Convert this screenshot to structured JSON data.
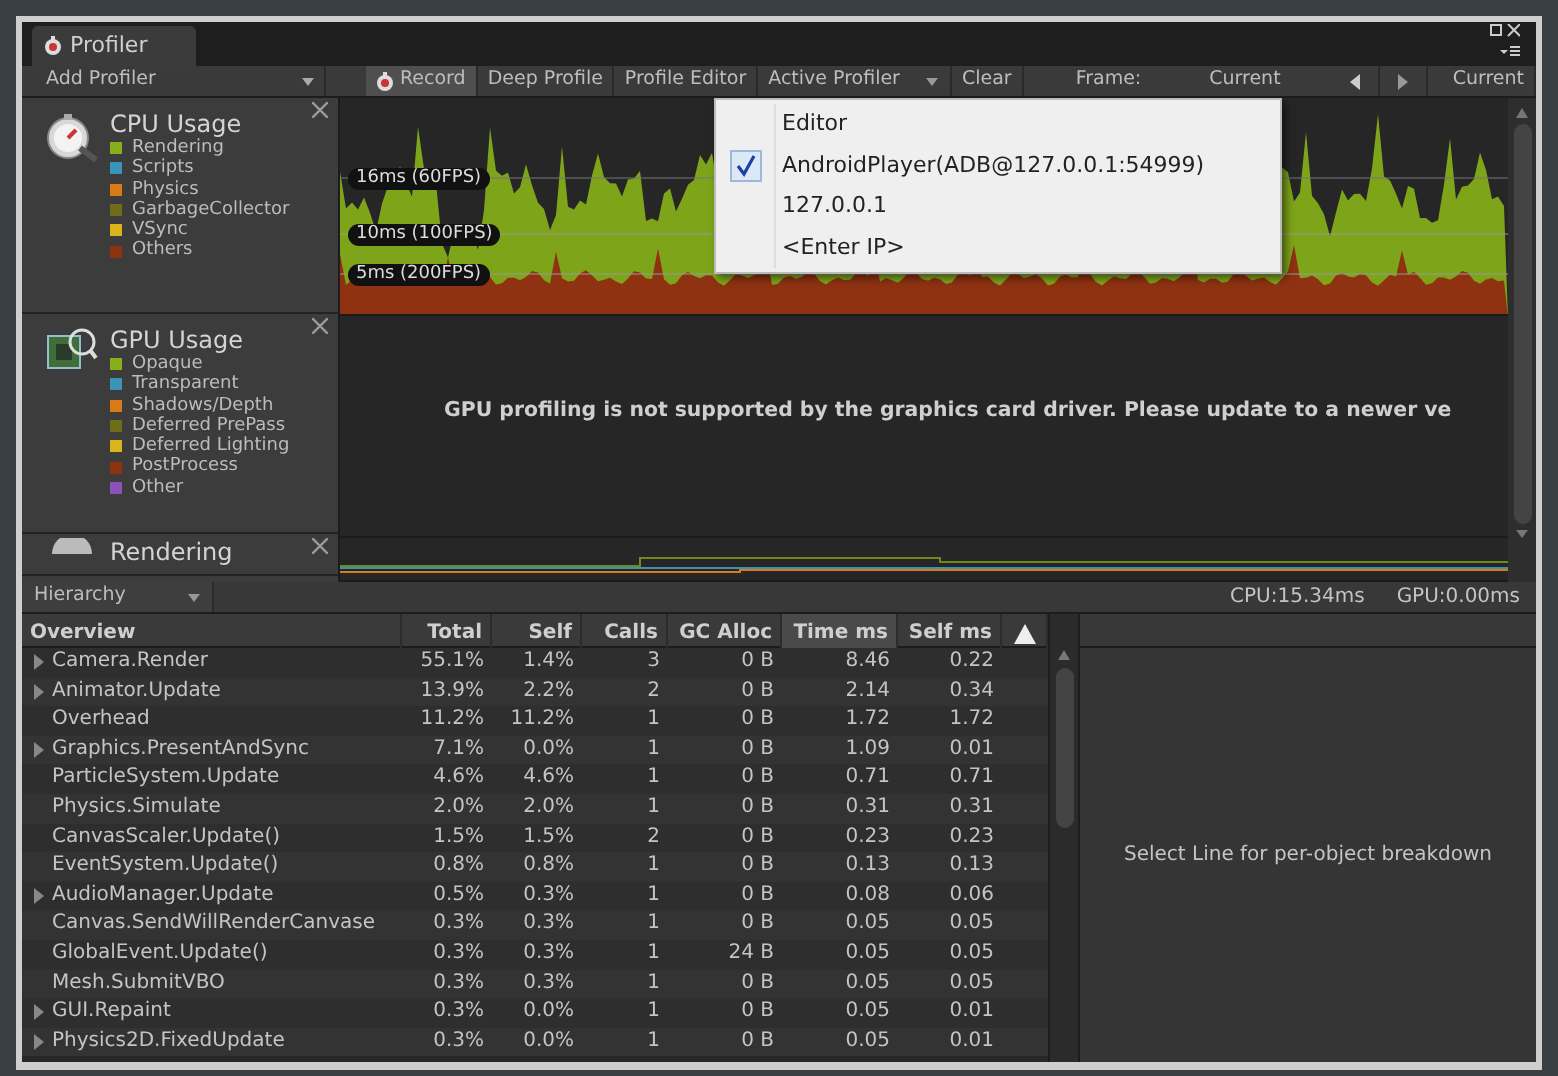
{
  "window": {
    "tab_title": "Profiler"
  },
  "toolbar": {
    "add_profiler": "Add Profiler",
    "buttons": [
      {
        "label": "Record",
        "kind": "record",
        "on": true
      },
      {
        "label": "Deep Profile",
        "kind": "toggle",
        "on": false
      },
      {
        "label": "Profile Editor",
        "kind": "toggle",
        "on": false
      },
      {
        "label": "Active Profiler",
        "kind": "dropdown",
        "on": false
      },
      {
        "label": "Clear",
        "kind": "toggle",
        "on": false
      }
    ],
    "frame_label": "Frame:",
    "frame_value": "Current",
    "current_button": "Current"
  },
  "active_profiler_menu": [
    {
      "label": "Editor",
      "checked": false
    },
    {
      "label": "AndroidPlayer(ADB@127.0.0.1:54999)",
      "checked": true
    },
    {
      "label": "127.0.0.1",
      "checked": false
    },
    {
      "label": "<Enter IP>",
      "checked": false
    }
  ],
  "modules": [
    {
      "title": "CPU Usage",
      "kind": "cpu",
      "legend": [
        {
          "label": "Rendering",
          "color": "#86b01a"
        },
        {
          "label": "Scripts",
          "color": "#3a94b8"
        },
        {
          "label": "Physics",
          "color": "#db7a18"
        },
        {
          "label": "GarbageCollector",
          "color": "#6e6c18"
        },
        {
          "label": "VSync",
          "color": "#d9b41a"
        },
        {
          "label": "Others",
          "color": "#8e3212"
        }
      ],
      "graph_labels": [
        "16ms (60FPS)",
        "10ms (100FPS)",
        "5ms (200FPS)"
      ]
    },
    {
      "title": "GPU Usage",
      "kind": "gpu",
      "legend": [
        {
          "label": "Opaque",
          "color": "#86b01a"
        },
        {
          "label": "Transparent",
          "color": "#3a94b8"
        },
        {
          "label": "Shadows/Depth",
          "color": "#db7a18"
        },
        {
          "label": "Deferred PrePass",
          "color": "#6e6c18"
        },
        {
          "label": "Deferred Lighting",
          "color": "#d9b41a"
        },
        {
          "label": "PostProcess",
          "color": "#8e3212"
        },
        {
          "label": "Other",
          "color": "#8a52b8"
        }
      ],
      "message": "GPU profiling is not supported by the graphics card driver. Please update to a newer ve"
    },
    {
      "title": "Rendering",
      "kind": "rendering"
    }
  ],
  "hierarchy": {
    "view": "Hierarchy",
    "cpu_time": "CPU:15.34ms",
    "gpu_time": "GPU:0.00ms",
    "columns": [
      {
        "label": "Overview",
        "selected": false
      },
      {
        "label": "Total",
        "selected": false
      },
      {
        "label": "Self",
        "selected": false
      },
      {
        "label": "Calls",
        "selected": false
      },
      {
        "label": "GC Alloc",
        "selected": false
      },
      {
        "label": "Time ms",
        "selected": true
      },
      {
        "label": "Self ms",
        "selected": false
      }
    ],
    "rows": [
      {
        "expandable": true,
        "cells": [
          "Camera.Render",
          "55.1%",
          "1.4%",
          "3",
          "0 B",
          "8.46",
          "0.22"
        ]
      },
      {
        "expandable": true,
        "cells": [
          "Animator.Update",
          "13.9%",
          "2.2%",
          "2",
          "0 B",
          "2.14",
          "0.34"
        ]
      },
      {
        "expandable": false,
        "cells": [
          "Overhead",
          "11.2%",
          "11.2%",
          "1",
          "0 B",
          "1.72",
          "1.72"
        ]
      },
      {
        "expandable": true,
        "cells": [
          "Graphics.PresentAndSync",
          "7.1%",
          "0.0%",
          "1",
          "0 B",
          "1.09",
          "0.01"
        ]
      },
      {
        "expandable": false,
        "cells": [
          "ParticleSystem.Update",
          "4.6%",
          "4.6%",
          "1",
          "0 B",
          "0.71",
          "0.71"
        ]
      },
      {
        "expandable": false,
        "cells": [
          "Physics.Simulate",
          "2.0%",
          "2.0%",
          "1",
          "0 B",
          "0.31",
          "0.31"
        ]
      },
      {
        "expandable": false,
        "cells": [
          "CanvasScaler.Update()",
          "1.5%",
          "1.5%",
          "2",
          "0 B",
          "0.23",
          "0.23"
        ]
      },
      {
        "expandable": false,
        "cells": [
          "EventSystem.Update()",
          "0.8%",
          "0.8%",
          "1",
          "0 B",
          "0.13",
          "0.13"
        ]
      },
      {
        "expandable": true,
        "cells": [
          "AudioManager.Update",
          "0.5%",
          "0.3%",
          "1",
          "0 B",
          "0.08",
          "0.06"
        ]
      },
      {
        "expandable": false,
        "cells": [
          "Canvas.SendWillRenderCanvase",
          "0.3%",
          "0.3%",
          "1",
          "0 B",
          "0.05",
          "0.05"
        ]
      },
      {
        "expandable": false,
        "cells": [
          "GlobalEvent.Update()",
          "0.3%",
          "0.3%",
          "1",
          "24 B",
          "0.05",
          "0.05"
        ]
      },
      {
        "expandable": false,
        "cells": [
          "Mesh.SubmitVBO",
          "0.3%",
          "0.3%",
          "1",
          "0 B",
          "0.05",
          "0.05"
        ]
      },
      {
        "expandable": true,
        "cells": [
          "GUI.Repaint",
          "0.3%",
          "0.0%",
          "1",
          "0 B",
          "0.05",
          "0.01"
        ]
      },
      {
        "expandable": true,
        "cells": [
          "Physics2D.FixedUpdate",
          "0.3%",
          "0.0%",
          "1",
          "0 B",
          "0.05",
          "0.01"
        ]
      }
    ]
  },
  "detail_message": "Select Line for per-object breakdown"
}
